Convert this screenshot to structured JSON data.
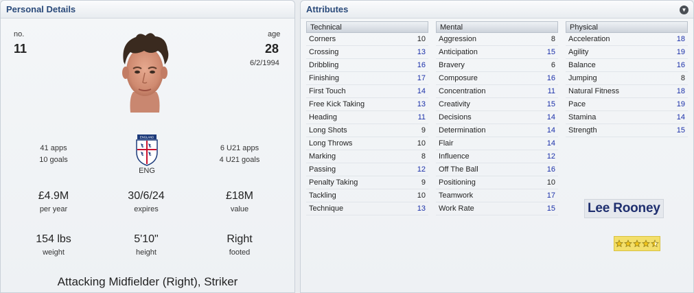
{
  "personal": {
    "title": "Personal Details",
    "no_label": "no.",
    "no_value": "11",
    "age_label": "age",
    "age_value": "28",
    "dob": "6/2/1994",
    "apps": "41 apps",
    "goals": "10 goals",
    "nation": "ENG",
    "crest_text": "ENGLAND",
    "u21_apps": "6 U21 apps",
    "u21_goals": "4 U21 goals",
    "wage_value": "£4.9M",
    "wage_label": "per year",
    "contract_value": "30/6/24",
    "contract_label": "expires",
    "value_value": "£18M",
    "value_label": "value",
    "weight_value": "154 lbs",
    "weight_label": "weight",
    "height_value": "5'10\"",
    "height_label": "height",
    "foot_value": "Right",
    "foot_label": "footed",
    "positions": "Attacking Midfielder (Right), Striker"
  },
  "attributes": {
    "title": "Attributes",
    "technical": {
      "label": "Technical",
      "rows": [
        {
          "name": "Corners",
          "value": "10",
          "hi": false
        },
        {
          "name": "Crossing",
          "value": "13",
          "hi": true
        },
        {
          "name": "Dribbling",
          "value": "16",
          "hi": true
        },
        {
          "name": "Finishing",
          "value": "17",
          "hi": true
        },
        {
          "name": "First Touch",
          "value": "14",
          "hi": true
        },
        {
          "name": "Free Kick Taking",
          "value": "13",
          "hi": true
        },
        {
          "name": "Heading",
          "value": "11",
          "hi": true
        },
        {
          "name": "Long Shots",
          "value": "9",
          "hi": false
        },
        {
          "name": "Long Throws",
          "value": "10",
          "hi": false
        },
        {
          "name": "Marking",
          "value": "8",
          "hi": false
        },
        {
          "name": "Passing",
          "value": "12",
          "hi": true
        },
        {
          "name": "Penalty Taking",
          "value": "9",
          "hi": false
        },
        {
          "name": "Tackling",
          "value": "10",
          "hi": false
        },
        {
          "name": "Technique",
          "value": "13",
          "hi": true
        }
      ]
    },
    "mental": {
      "label": "Mental",
      "rows": [
        {
          "name": "Aggression",
          "value": "8",
          "hi": false
        },
        {
          "name": "Anticipation",
          "value": "15",
          "hi": true
        },
        {
          "name": "Bravery",
          "value": "6",
          "hi": false
        },
        {
          "name": "Composure",
          "value": "16",
          "hi": true
        },
        {
          "name": "Concentration",
          "value": "11",
          "hi": true
        },
        {
          "name": "Creativity",
          "value": "15",
          "hi": true
        },
        {
          "name": "Decisions",
          "value": "14",
          "hi": true
        },
        {
          "name": "Determination",
          "value": "14",
          "hi": true
        },
        {
          "name": "Flair",
          "value": "14",
          "hi": true
        },
        {
          "name": "Influence",
          "value": "12",
          "hi": true
        },
        {
          "name": "Off The Ball",
          "value": "16",
          "hi": true
        },
        {
          "name": "Positioning",
          "value": "10",
          "hi": false
        },
        {
          "name": "Teamwork",
          "value": "17",
          "hi": true
        },
        {
          "name": "Work Rate",
          "value": "15",
          "hi": true
        }
      ]
    },
    "physical": {
      "label": "Physical",
      "rows": [
        {
          "name": "Acceleration",
          "value": "18",
          "hi": true
        },
        {
          "name": "Agility",
          "value": "19",
          "hi": true
        },
        {
          "name": "Balance",
          "value": "16",
          "hi": true
        },
        {
          "name": "Jumping",
          "value": "8",
          "hi": false
        },
        {
          "name": "Natural Fitness",
          "value": "18",
          "hi": true
        },
        {
          "name": "Pace",
          "value": "19",
          "hi": true
        },
        {
          "name": "Stamina",
          "value": "14",
          "hi": true
        },
        {
          "name": "Strength",
          "value": "15",
          "hi": true
        }
      ]
    },
    "player_name": "Lee Rooney",
    "star_rating": 4.5,
    "star_icon": "star-icon"
  },
  "colors": {
    "header_text": "#2a4a7a",
    "highlight_value": "#1a2fa8",
    "star_box": "#f3df6a"
  }
}
